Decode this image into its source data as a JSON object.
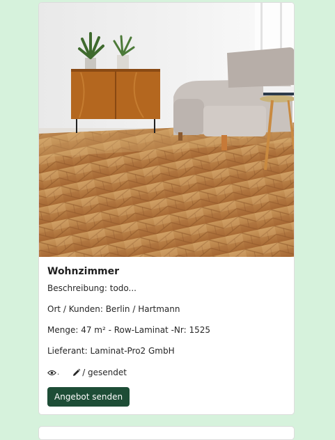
{
  "card": {
    "title": "Wohnzimmer",
    "description": "Beschreibung: todo...",
    "location": "Ort / Kunden: Berlin / Hartmann",
    "quantity": "Menge: 47 m² - Row-Laminat -Nr: 1525",
    "supplier": "Lieferant: Laminat-Pro2 GmbH",
    "status_suffix": "/ gesendet",
    "eye_suffix": ".",
    "button_label": "Angebot senden",
    "icons": {
      "view": "eye-icon",
      "edit": "pencil-icon"
    },
    "image": "living-room-herringbone-parquet-photo"
  },
  "colors": {
    "page_background": "#d6f2dc",
    "button_background": "#1d4d36",
    "button_text": "#ffffff"
  }
}
